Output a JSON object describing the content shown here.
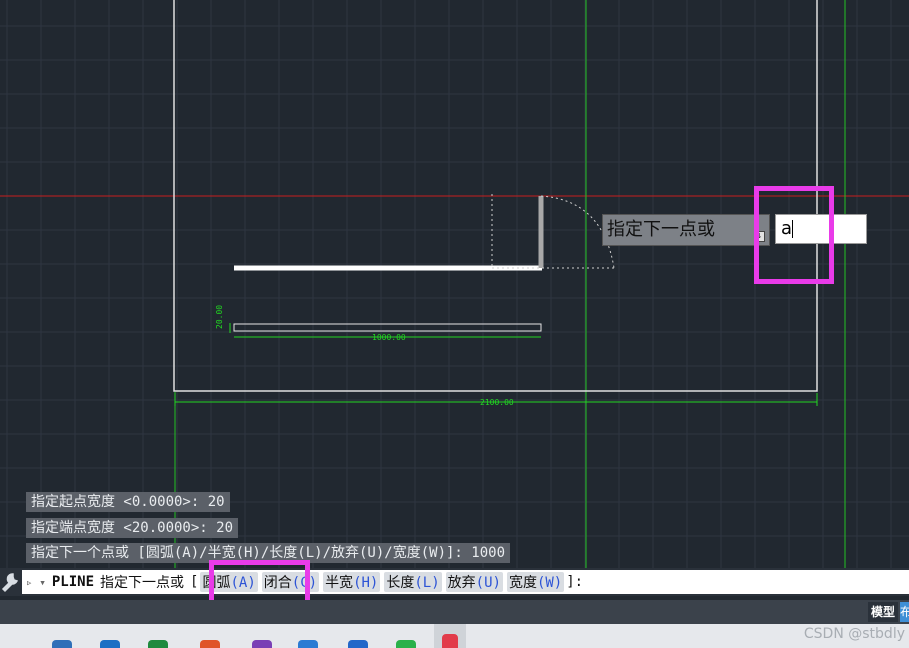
{
  "drawing": {
    "dim_width": "20.00",
    "dim_length": "1000.00",
    "dim_total": "2100.00"
  },
  "history": [
    "指定起点宽度 <0.0000>: 20",
    "指定端点宽度 <20.0000>: 20",
    "指定下一个点或 [圆弧(A)/半宽(H)/长度(L)/放弃(U)/宽度(W)]: 1000"
  ],
  "command_line": {
    "command": "PLINE",
    "prompt": "指定下一点或",
    "bracket_open": "[",
    "options": [
      {
        "label": "圆弧",
        "key": "(A)"
      },
      {
        "label": "闭合",
        "key": "(C)"
      },
      {
        "label": "半宽",
        "key": "(H)"
      },
      {
        "label": "长度",
        "key": "(L)"
      },
      {
        "label": "放弃",
        "key": "(U)"
      },
      {
        "label": "宽度",
        "key": "(W)"
      }
    ],
    "bracket_close": "]:"
  },
  "dynamic_prompt": {
    "label": "指定下一点或",
    "input_value": "a"
  },
  "status_bar": {
    "model_tab": "模型",
    "layout_tab": "布"
  },
  "watermark": "CSDN @stbdly",
  "colors": {
    "background": "#212830",
    "grid": "#2f3742",
    "highlight": "#e93be9",
    "dimension": "#22d622",
    "axis_red": "#c81e1e"
  }
}
